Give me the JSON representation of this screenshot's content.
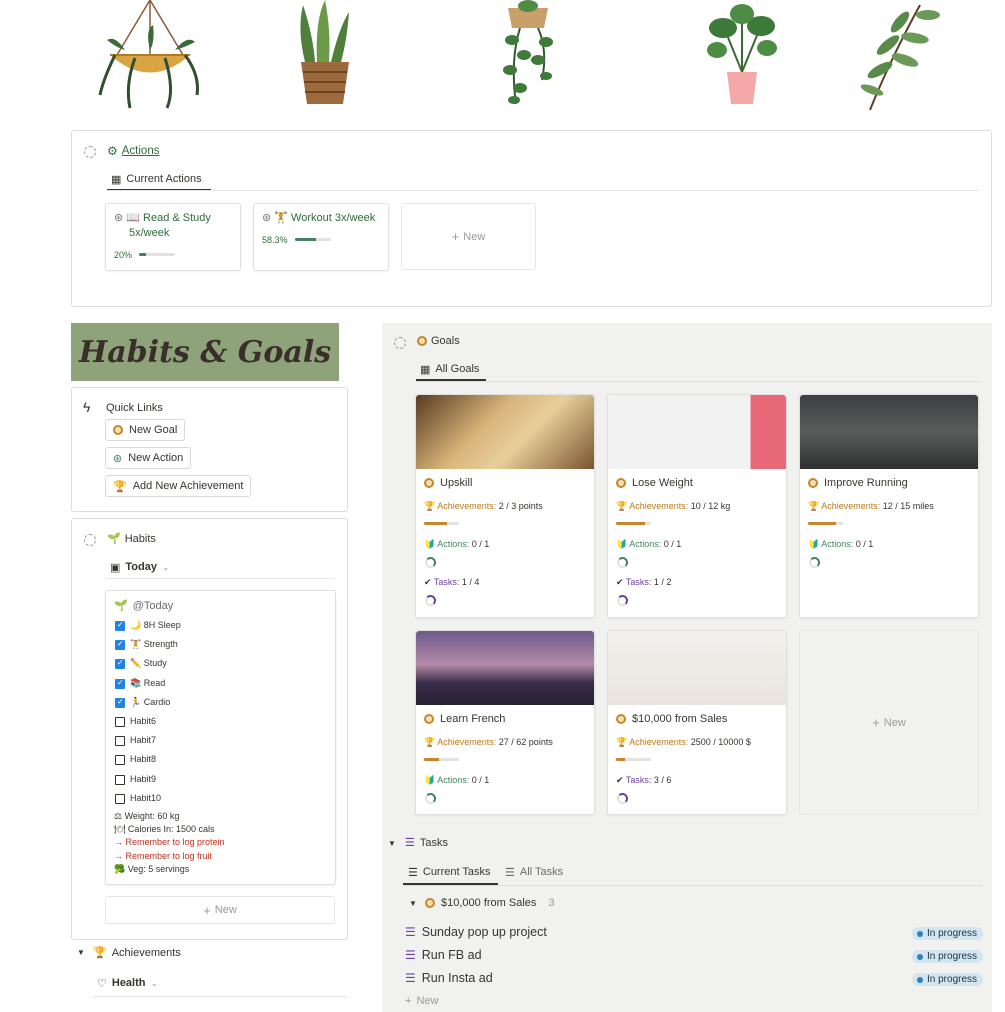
{
  "actions": {
    "title": "Actions",
    "tab": "Current Actions",
    "cards": [
      {
        "icon": "📖",
        "title_line1": "Read & Study",
        "title_line2": "5x/week",
        "progress_label": "20%",
        "progress": 0.2
      },
      {
        "icon": "🏋",
        "title_line1": "Workout 3x/week",
        "progress_label": "58.3%",
        "progress": 0.583
      }
    ],
    "new_label": "New"
  },
  "banner": {
    "text": "Habits & Goals"
  },
  "quick_links": {
    "title": "Quick Links",
    "new_goal": "New Goal",
    "new_action": "New Action",
    "add_achievement": "Add New Achievement"
  },
  "habits": {
    "title": "Habits",
    "view": "Today",
    "card_title": "@Today",
    "items": [
      {
        "label": "🌙 8H Sleep",
        "checked": true
      },
      {
        "label": "🏋 Strength",
        "checked": true
      },
      {
        "label": "✏️ Study",
        "checked": true
      },
      {
        "label": "📚 Read",
        "checked": true
      },
      {
        "label": "🏃 Cardio",
        "checked": true
      },
      {
        "label": "Habit6",
        "checked": false
      },
      {
        "label": "Habit7",
        "checked": false
      },
      {
        "label": "Habit8",
        "checked": false
      },
      {
        "label": "Habit9",
        "checked": false
      },
      {
        "label": "Habit10",
        "checked": false
      }
    ],
    "notes": [
      {
        "text": "⚖ Weight: 60 kg",
        "color": "#37352f"
      },
      {
        "text": "🍽 Calories In: 1500 cals",
        "color": "#37352f"
      },
      {
        "text": "→ Remember to log protein",
        "color": "#c4301c"
      },
      {
        "text": "→ Remember to log fruit",
        "color": "#c4301c"
      },
      {
        "text": "🥦 Veg: 5 servings",
        "color": "#37352f"
      }
    ],
    "new_label": "New"
  },
  "achievements": {
    "title": "Achievements",
    "view": "Health"
  },
  "goals": {
    "title": "Goals",
    "tab": "All Goals",
    "achievements_label": "Achievements:",
    "actions_label": "Actions:",
    "tasks_label": "Tasks:",
    "cards": [
      {
        "title": "Upskill",
        "achievements": "2 / 3 points",
        "ach_progress": 0.667,
        "actions": "0 / 1",
        "tasks": "1 / 4"
      },
      {
        "title": "Lose Weight",
        "achievements": "10 / 12 kg",
        "ach_progress": 0.833,
        "actions": "0 / 1",
        "tasks": "1 / 2"
      },
      {
        "title": "Improve Running",
        "achievements": "12 / 15 miles",
        "ach_progress": 0.8,
        "actions": "0 / 1"
      },
      {
        "title": "Learn French",
        "achievements": "27 / 62 points",
        "ach_progress": 0.435,
        "actions": "0 / 1"
      },
      {
        "title": "$10,000 from Sales",
        "achievements": "2500 / 10000 $",
        "ach_progress": 0.25,
        "tasks": "3 / 6"
      }
    ],
    "new_label": "New"
  },
  "tasks": {
    "title": "Tasks",
    "tab_current": "Current Tasks",
    "tab_all": "All Tasks",
    "group_label": "$10,000 from Sales",
    "group_count": "3",
    "rows": [
      {
        "name": "Sunday pop up project",
        "status": "In progress"
      },
      {
        "name": "Run FB ad",
        "status": "In progress"
      },
      {
        "name": "Run Insta ad",
        "status": "In progress"
      }
    ],
    "new_label": "New"
  }
}
